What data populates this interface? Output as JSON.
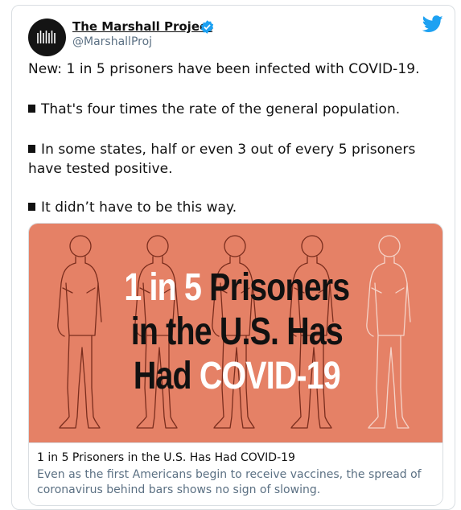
{
  "author": {
    "display_name": "The Marshall Project",
    "handle": "@MarshallProj",
    "verified": true,
    "avatar_icon": "marshall-project-logo-icon"
  },
  "brand": {
    "twitter_icon": "twitter-bird-icon",
    "accent": "#1da1f2"
  },
  "tweet": {
    "p1": "New: 1 in 5 prisoners have been infected with COVID-19.",
    "p2": "That's four times the rate of the general population.",
    "p3": "In some states, half or even 3 out of every 5 prisoners have tested positive.",
    "p4": "It didn’t have to be this way."
  },
  "card": {
    "image": {
      "line1_a": "1 in 5",
      "line1_b": "Prisoners",
      "line2": "in the U.S. Has",
      "line3_a": "Had",
      "line3_b": "COVID-19",
      "background": "#e58166"
    },
    "title": "1 in 5 Prisoners in the U.S. Has Had COVID-19",
    "description": "Even as the first Americans begin to receive vaccines, the spread of coronavirus behind bars shows no sign of slowing."
  }
}
